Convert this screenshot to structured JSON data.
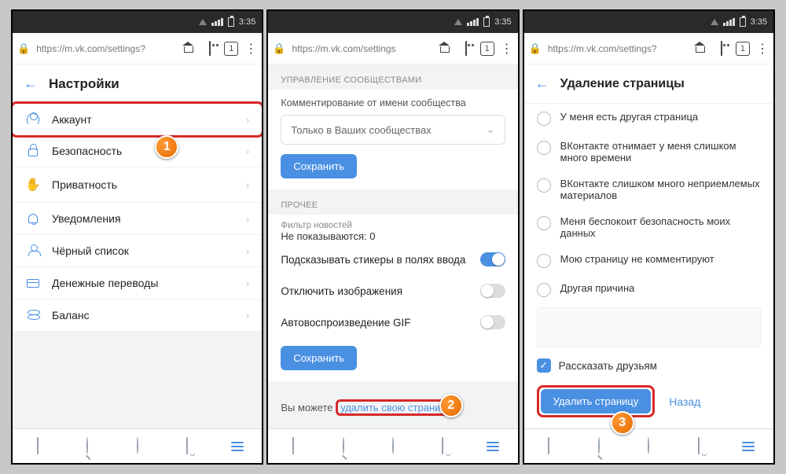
{
  "status": {
    "time": "3:35"
  },
  "urlbar": {
    "url1": "https://m.vk.com/settings?",
    "url2": "https://m.vk.com/settings",
    "url3": "https://m.vk.com/settings?",
    "tabs": "1"
  },
  "p1": {
    "title": "Настройки",
    "items": [
      {
        "label": "Аккаунт"
      },
      {
        "label": "Безопасность"
      },
      {
        "label": "Приватность"
      },
      {
        "label": "Уведомления"
      },
      {
        "label": "Чёрный список"
      },
      {
        "label": "Денежные переводы"
      },
      {
        "label": "Баланс"
      }
    ]
  },
  "p2": {
    "sec1_head": "УПРАВЛЕНИЕ СООБЩЕСТВАМИ",
    "comment_label": "Комментирование от имени сообщества",
    "comment_value": "Только в Ваших сообществах",
    "save": "Сохранить",
    "sec2_head": "ПРОЧЕЕ",
    "filter_lbl": "Фильтр новостей",
    "filter_val": "Не показываются: 0",
    "opt_stickers": "Подсказывать стикеры в полях ввода",
    "opt_images": "Отключить изображения",
    "opt_gif": "Автовоспроизведение GIF",
    "bottom_pre": "Вы можете ",
    "bottom_link": "удалить свою страницу."
  },
  "p3": {
    "title": "Удаление страницы",
    "reasons": [
      "У меня есть другая страница",
      "ВКонтакте отнимает у меня слишком много времени",
      "ВКонтакте слишком много неприемлемых материалов",
      "Меня беспокоит безопасность моих данных",
      "Мою страницу не комментируют",
      "Другая причина"
    ],
    "tell": "Рассказать друзьям",
    "delete_btn": "Удалить страницу",
    "back": "Назад"
  },
  "badges": {
    "b1": "1",
    "b2": "2",
    "b3": "3"
  }
}
